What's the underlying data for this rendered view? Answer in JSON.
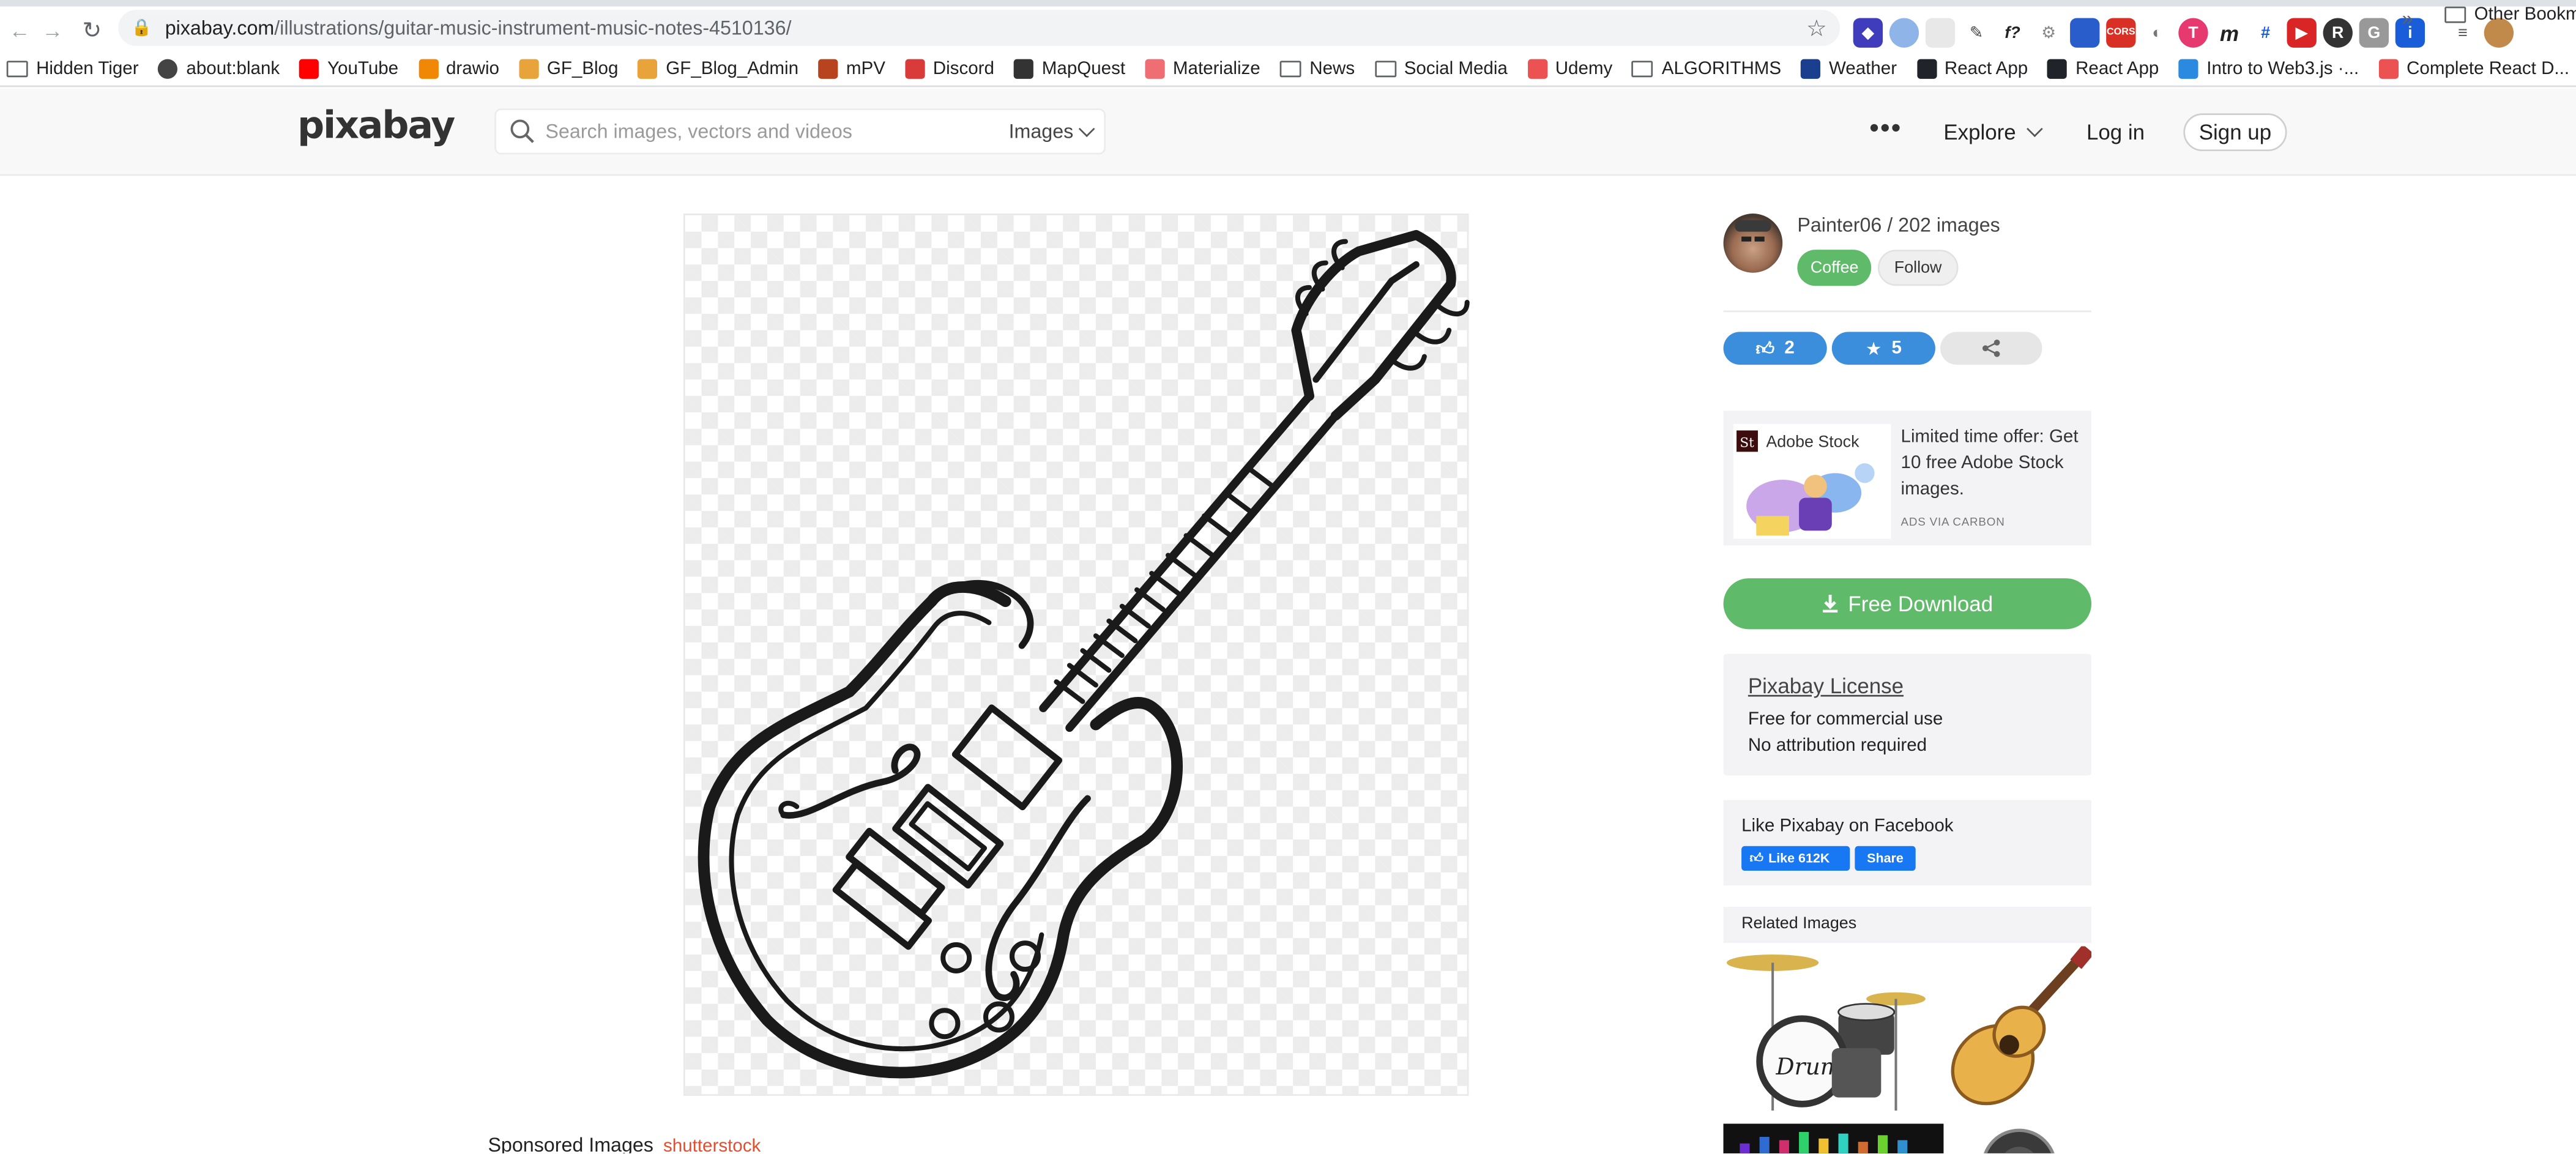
{
  "browser": {
    "url_host": "pixabay.com",
    "url_path": "/illustrations/guitar-music-instrument-music-notes-4510136/",
    "bookmarks": [
      {
        "label": "Hidden Tiger",
        "icon": "folder-icon"
      },
      {
        "label": "about:blank",
        "icon": "globe-icon"
      },
      {
        "label": "YouTube",
        "icon": "youtube-icon"
      },
      {
        "label": "drawio",
        "icon": "drawio-icon"
      },
      {
        "label": "GF_Blog",
        "icon": "blog-icon"
      },
      {
        "label": "GF_Blog_Admin",
        "icon": "blog-icon"
      },
      {
        "label": "mPV",
        "icon": "mpv-icon"
      },
      {
        "label": "Discord",
        "icon": "discord-icon"
      },
      {
        "label": "MapQuest",
        "icon": "map-icon"
      },
      {
        "label": "Materialize",
        "icon": "materialize-icon"
      },
      {
        "label": "News",
        "icon": "folder-icon"
      },
      {
        "label": "Social Media",
        "icon": "folder-icon"
      },
      {
        "label": "Udemy",
        "icon": "udemy-icon"
      },
      {
        "label": "ALGORITHMS",
        "icon": "folder-icon"
      },
      {
        "label": "Weather",
        "icon": "weather-icon"
      },
      {
        "label": "React App",
        "icon": "react-icon"
      },
      {
        "label": "React App",
        "icon": "react-icon"
      },
      {
        "label": "Intro to Web3.js ·...",
        "icon": "web3-icon"
      },
      {
        "label": "Complete React D...",
        "icon": "udemy-icon"
      }
    ],
    "more": "»",
    "other_bookmarks": "Other Bookmar"
  },
  "header": {
    "logo": "pixabay",
    "search_placeholder": "Search images, vectors and videos",
    "search_type": "Images",
    "more_dots": "•••",
    "explore": "Explore",
    "login": "Log in",
    "signup": "Sign up"
  },
  "author": {
    "name_line": "Painter06 / 202 images",
    "coffee": "Coffee",
    "follow": "Follow"
  },
  "stats": {
    "likes": "2",
    "favorites": "5"
  },
  "ad": {
    "brand": "Adobe Stock",
    "text": "Limited time offer: Get 10 free Adobe Stock images.",
    "via": "ADS VIA CARBON"
  },
  "download": {
    "label": "Free Download"
  },
  "license": {
    "title": "Pixabay License",
    "line1": "Free for commercial use",
    "line2": "No attribution required"
  },
  "facebook": {
    "title": "Like Pixabay on Facebook",
    "like": "Like 612K",
    "share": "Share"
  },
  "related": {
    "title": "Related Images"
  },
  "sponsored": {
    "label": "Sponsored Images",
    "brand": "shutterstock"
  },
  "colors": {
    "accent_green": "#5fbb6a",
    "accent_blue": "#3b8edb",
    "facebook_blue": "#1877f2"
  }
}
